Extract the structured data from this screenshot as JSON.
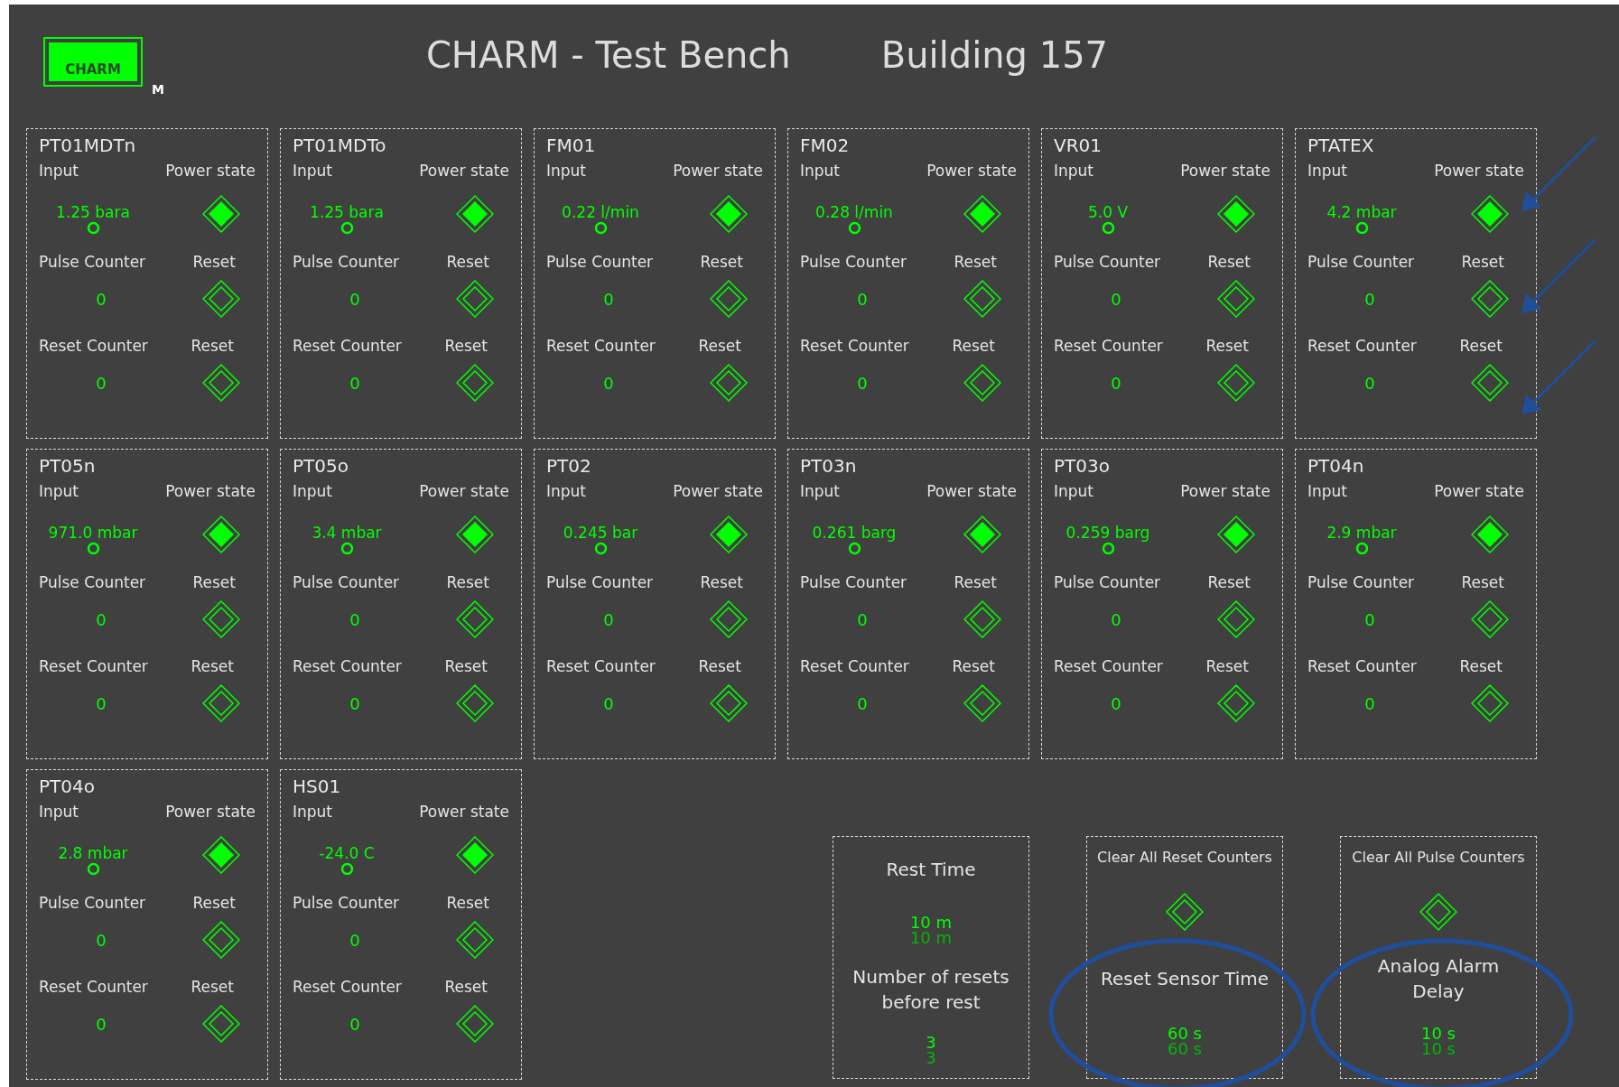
{
  "header": {
    "logo": "CHARM",
    "logo_mark": "M",
    "title": "CHARM - Test Bench",
    "building": "Building 157"
  },
  "sensors": [
    {
      "name": "PT01MDTn",
      "input_label": "Input",
      "power_label": "Power state",
      "value": "1.25 bara",
      "powered": true,
      "pulse_label": "Pulse Counter",
      "pulse_reset_label": "Reset",
      "pulse_count": "0",
      "reset_counter_label": "Reset Counter",
      "reset_counter_reset_label": "Reset",
      "reset_count": "0"
    },
    {
      "name": "PT01MDTo",
      "input_label": "Input",
      "power_label": "Power state",
      "value": "1.25 bara",
      "powered": true,
      "pulse_label": "Pulse Counter",
      "pulse_reset_label": "Reset",
      "pulse_count": "0",
      "reset_counter_label": "Reset Counter",
      "reset_counter_reset_label": "Reset",
      "reset_count": "0"
    },
    {
      "name": "FM01",
      "input_label": "Input",
      "power_label": "Power state",
      "value": "0.22 l/min",
      "powered": true,
      "pulse_label": "Pulse Counter",
      "pulse_reset_label": "Reset",
      "pulse_count": "0",
      "reset_counter_label": "Reset Counter",
      "reset_counter_reset_label": "Reset",
      "reset_count": "0"
    },
    {
      "name": "FM02",
      "input_label": "Input",
      "power_label": "Power state",
      "value": "0.28 l/min",
      "powered": true,
      "pulse_label": "Pulse Counter",
      "pulse_reset_label": "Reset",
      "pulse_count": "0",
      "reset_counter_label": "Reset Counter",
      "reset_counter_reset_label": "Reset",
      "reset_count": "0"
    },
    {
      "name": "VR01",
      "input_label": "Input",
      "power_label": "Power state",
      "value": "5.0 V",
      "powered": true,
      "pulse_label": "Pulse Counter",
      "pulse_reset_label": "Reset",
      "pulse_count": "0",
      "reset_counter_label": "Reset Counter",
      "reset_counter_reset_label": "Reset",
      "reset_count": "0"
    },
    {
      "name": "PTATEX",
      "input_label": "Input",
      "power_label": "Power state",
      "value": "4.2 mbar",
      "powered": true,
      "pulse_label": "Pulse Counter",
      "pulse_reset_label": "Reset",
      "pulse_count": "0",
      "reset_counter_label": "Reset Counter",
      "reset_counter_reset_label": "Reset",
      "reset_count": "0"
    },
    {
      "name": "PT05n",
      "input_label": "Input",
      "power_label": "Power state",
      "value": "971.0 mbar",
      "powered": true,
      "pulse_label": "Pulse Counter",
      "pulse_reset_label": "Reset",
      "pulse_count": "0",
      "reset_counter_label": "Reset Counter",
      "reset_counter_reset_label": "Reset",
      "reset_count": "0"
    },
    {
      "name": "PT05o",
      "input_label": "Input",
      "power_label": "Power state",
      "value": "3.4 mbar",
      "powered": true,
      "pulse_label": "Pulse Counter",
      "pulse_reset_label": "Reset",
      "pulse_count": "0",
      "reset_counter_label": "Reset Counter",
      "reset_counter_reset_label": "Reset",
      "reset_count": "0"
    },
    {
      "name": "PT02",
      "input_label": "Input",
      "power_label": "Power state",
      "value": "0.245 bar",
      "powered": true,
      "pulse_label": "Pulse Counter",
      "pulse_reset_label": "Reset",
      "pulse_count": "0",
      "reset_counter_label": "Reset Counter",
      "reset_counter_reset_label": "Reset",
      "reset_count": "0"
    },
    {
      "name": "PT03n",
      "input_label": "Input",
      "power_label": "Power state",
      "value": "0.261 barg",
      "powered": true,
      "pulse_label": "Pulse Counter",
      "pulse_reset_label": "Reset",
      "pulse_count": "0",
      "reset_counter_label": "Reset Counter",
      "reset_counter_reset_label": "Reset",
      "reset_count": "0"
    },
    {
      "name": "PT03o",
      "input_label": "Input",
      "power_label": "Power state",
      "value": "0.259 barg",
      "powered": true,
      "pulse_label": "Pulse Counter",
      "pulse_reset_label": "Reset",
      "pulse_count": "0",
      "reset_counter_label": "Reset Counter",
      "reset_counter_reset_label": "Reset",
      "reset_count": "0"
    },
    {
      "name": "PT04n",
      "input_label": "Input",
      "power_label": "Power state",
      "value": "2.9 mbar",
      "powered": true,
      "pulse_label": "Pulse Counter",
      "pulse_reset_label": "Reset",
      "pulse_count": "0",
      "reset_counter_label": "Reset Counter",
      "reset_counter_reset_label": "Reset",
      "reset_count": "0"
    },
    {
      "name": "PT04o",
      "input_label": "Input",
      "power_label": "Power state",
      "value": "2.8 mbar",
      "powered": true,
      "pulse_label": "Pulse Counter",
      "pulse_reset_label": "Reset",
      "pulse_count": "0",
      "reset_counter_label": "Reset Counter",
      "reset_counter_reset_label": "Reset",
      "reset_count": "0"
    },
    {
      "name": "HS01",
      "input_label": "Input",
      "power_label": "Power state",
      "value": "-24.0 C",
      "powered": true,
      "pulse_label": "Pulse Counter",
      "pulse_reset_label": "Reset",
      "pulse_count": "0",
      "reset_counter_label": "Reset Counter",
      "reset_counter_reset_label": "Reset",
      "reset_count": "0"
    }
  ],
  "settings": [
    {
      "sections": [
        {
          "kind": "heading",
          "text": "Rest Time"
        },
        {
          "kind": "reading",
          "value": "10 m",
          "echo": "10 m"
        },
        {
          "kind": "heading",
          "text": "Number of resets before rest"
        },
        {
          "kind": "reading",
          "value": "3",
          "echo": "3"
        }
      ]
    },
    {
      "sections": [
        {
          "kind": "caption",
          "text": "Clear All Reset Counters"
        },
        {
          "kind": "button"
        },
        {
          "kind": "heading",
          "text": "Reset Sensor Time"
        },
        {
          "kind": "reading",
          "value": "60 s",
          "echo": "60 s"
        }
      ]
    },
    {
      "sections": [
        {
          "kind": "caption",
          "text": "Clear All Pulse Counters"
        },
        {
          "kind": "button"
        },
        {
          "kind": "heading",
          "text": "Analog Alarm Delay"
        },
        {
          "kind": "reading",
          "value": "10 s",
          "echo": "10 s"
        }
      ]
    }
  ]
}
